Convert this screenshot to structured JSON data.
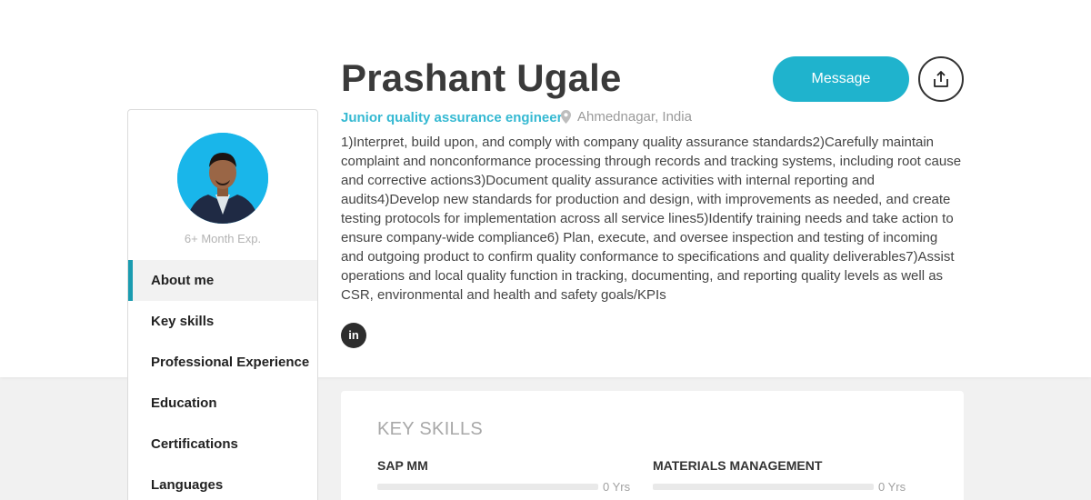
{
  "profile": {
    "name": "Prashant Ugale",
    "role": "Junior quality assurance engineer",
    "location": "Ahmednagar, India",
    "experience": "6+ Month Exp.",
    "about": "1)Interpret, build upon, and comply with company quality assurance standards2)Carefully maintain complaint and nonconformance processing through records and tracking systems, including root cause and corrective actions3)Document quality assurance activities with internal reporting and audits4)Develop new standards for production and design, with improvements as needed, and create testing protocols for implementation across all service lines5)Identify training needs and take action to ensure company-wide compliance6) Plan, execute, and oversee inspection and testing of incoming and outgoing product to confirm quality conformance to specifications and quality deliverables7)Assist operations and local quality function in tracking, documenting, and reporting quality levels as well as CSR, environmental and health and safety goals/KPIs"
  },
  "actions": {
    "message_label": "Message",
    "share_icon": "share-upload-icon"
  },
  "social": {
    "linkedin_label": "in",
    "linkedin_icon": "linkedin-icon"
  },
  "sidebar": {
    "items": [
      {
        "label": "About me",
        "active": true
      },
      {
        "label": "Key skills",
        "active": false
      },
      {
        "label": "Professional Experience",
        "active": false
      },
      {
        "label": "Education",
        "active": false
      },
      {
        "label": "Certifications",
        "active": false
      },
      {
        "label": "Languages",
        "active": false
      }
    ]
  },
  "key_skills": {
    "title": "KEY SKILLS",
    "items": [
      {
        "name": "SAP MM",
        "years": "0 Yrs",
        "level": 0
      },
      {
        "name": "MATERIALS MANAGEMENT",
        "years": "0 Yrs",
        "level": 0
      }
    ]
  },
  "colors": {
    "accent": "#1fb3cd",
    "role_text": "#35b9d2",
    "active_border": "#1a9cb0",
    "avatar_bg": "#19b6ea"
  }
}
